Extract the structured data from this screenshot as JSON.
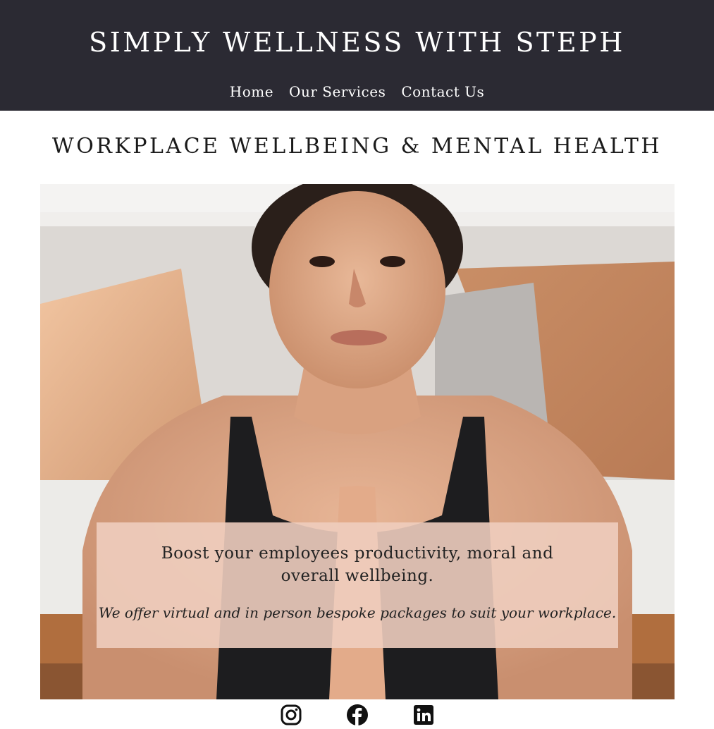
{
  "header": {
    "site_title": "SIMPLY WELLNESS WITH STEPH",
    "nav": [
      {
        "label": "Home"
      },
      {
        "label": "Our Services"
      },
      {
        "label": "Contact Us"
      }
    ]
  },
  "main": {
    "heading": "WORKPLACE WELLBEING & MENTAL HEALTH",
    "hero": {
      "image_alt": "woman in prayer pose",
      "overlay_main": "Boost your employees productivity, moral and overall wellbeing.",
      "overlay_sub": "We offer virtual and in person bespoke packages to suit your workplace."
    }
  },
  "footer": {
    "social": [
      {
        "icon": "instagram-icon"
      },
      {
        "icon": "facebook-icon"
      },
      {
        "icon": "linkedin-icon"
      }
    ]
  },
  "colors": {
    "header_bg": "#2b2a33",
    "overlay_bg": "#eecdbe"
  }
}
